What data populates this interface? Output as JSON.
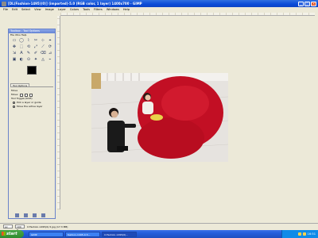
{
  "window": {
    "title": "[DL(Fashion-1495)(0)] (imported)-5.0 (RGB color, 1 layer) 1400x700 - GIMP",
    "buttons": {
      "minimize": "_",
      "maximize": "□",
      "close": "×"
    }
  },
  "menubar": {
    "items": [
      "File",
      "Edit",
      "Select",
      "View",
      "Image",
      "Layer",
      "Colors",
      "Tools",
      "Filters",
      "Windows",
      "Help"
    ]
  },
  "toolbox": {
    "title": "Toolbox - Tool Options",
    "menu_label": "File  Xtns  Help",
    "tools": [
      "▭",
      "◯",
      "⌇",
      "✂",
      "⊹",
      "⌖",
      "✥",
      "⬚",
      "⟲",
      "⤢",
      "⟋",
      "⟳",
      "⇲",
      "A",
      "✎",
      "✐",
      "⌫",
      "⊿",
      "▣",
      "◐",
      "⊙",
      "✦",
      "◬",
      "⌁"
    ],
    "tab_label": "Tool Options",
    "options": {
      "heading": "Move",
      "mode_label": "Move:",
      "toggle_label": "Tool Toggle (Shift)",
      "radio_1": "Pick a layer or guide",
      "radio_2": "Move the active layer"
    }
  },
  "statusbar": {
    "unit": "px",
    "zoom": "100 %",
    "filename": "X.Fashion-1495(0)-5.jpg (17.3 MB)"
  },
  "taskbar": {
    "start_label": "start",
    "tasks": [
      "GIMP",
      "fashion-1495-0-5...",
      "X.Fashion-1495(0)..."
    ],
    "clock": "16:51"
  },
  "colors": {
    "titlebar_blue": "#0a4ad8",
    "dress_red": "#c8102e",
    "taskbar_blue": "#245edb"
  }
}
